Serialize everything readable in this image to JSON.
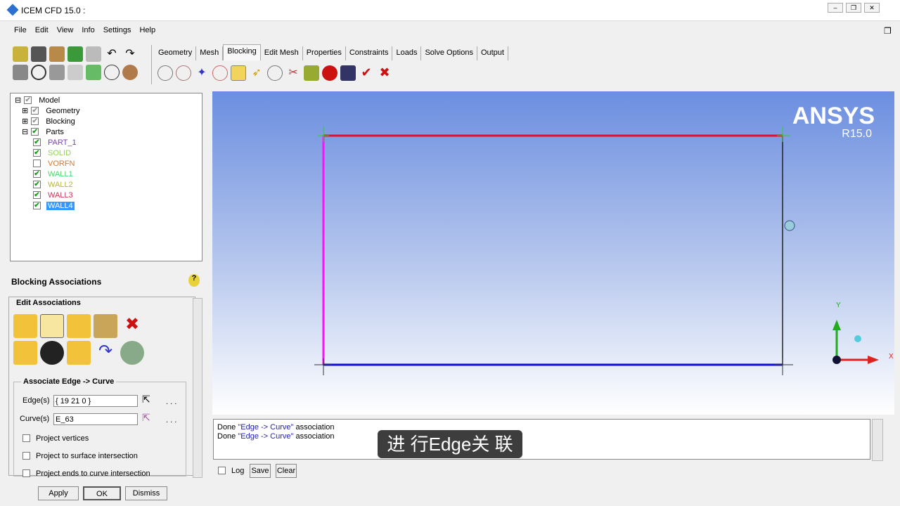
{
  "window": {
    "title": "ICEM CFD 15.0 :"
  },
  "menu": [
    "File",
    "Edit",
    "View",
    "Info",
    "Settings",
    "Help"
  ],
  "tabs": [
    "Geometry",
    "Mesh",
    "Blocking",
    "Edit Mesh",
    "Properties",
    "Constraints",
    "Loads",
    "Solve Options",
    "Output"
  ],
  "active_tab": "Blocking",
  "tree": {
    "root": "Model",
    "groups": [
      "Geometry",
      "Blocking",
      "Parts"
    ],
    "parts": [
      {
        "name": "PART_1",
        "color": "#7a3fbf",
        "checked": true
      },
      {
        "name": "SOLID",
        "color": "#8fd35a",
        "checked": true
      },
      {
        "name": "VORFN",
        "color": "#d07a3a",
        "checked": false
      },
      {
        "name": "WALL1",
        "color": "#4fd36a",
        "checked": true
      },
      {
        "name": "WALL2",
        "color": "#b7b53a",
        "checked": true
      },
      {
        "name": "WALL3",
        "color": "#c8365a",
        "checked": true
      },
      {
        "name": "WALL4",
        "color": "#ffffff",
        "checked": true,
        "selected": true
      }
    ]
  },
  "panel": {
    "title": "Blocking Associations",
    "section": "Edit Associations",
    "subsection": "Associate Edge -> Curve",
    "edges_label": "Edge(s)",
    "edges_value": "{ 19 21 0 }",
    "curves_label": "Curve(s)",
    "curves_value": "E_63",
    "dots": ". . .",
    "options": [
      "Project vertices",
      "Project to surface intersection",
      "Project ends to curve intersection"
    ],
    "apply": "Apply",
    "ok": "OK",
    "dismiss": "Dismiss"
  },
  "viewport": {
    "brand": "ANSYS",
    "version": "R15.0",
    "axis_y": "Y",
    "axis_x": "X"
  },
  "log": {
    "lines": [
      {
        "pre": "Done ",
        "q": "\"Edge -> Curve\"",
        "post": " association"
      },
      {
        "pre": "Done ",
        "q": "\"Edge -> Curve\"",
        "post": " association"
      }
    ],
    "log_label": "Log",
    "save": "Save",
    "clear": "Clear"
  },
  "subtitle": "进 行Edge关 联"
}
